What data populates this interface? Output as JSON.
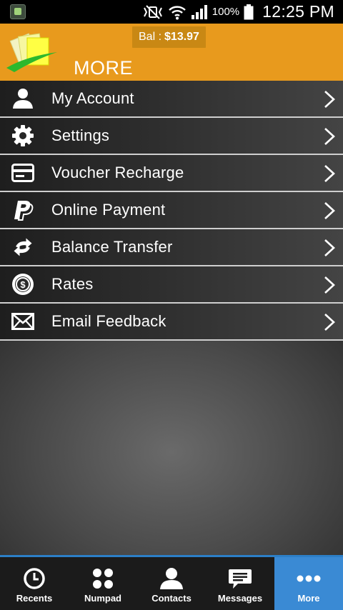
{
  "status_bar": {
    "battery_pct": "100%",
    "time": "12:25 PM"
  },
  "header": {
    "title": "MORE",
    "balance_label": "Bal :",
    "balance_value": "$13.97",
    "brand_color": "#e89a1d"
  },
  "menu": {
    "items": [
      {
        "label": "My Account",
        "icon": "user-icon"
      },
      {
        "label": "Settings",
        "icon": "gear-icon"
      },
      {
        "label": "Voucher Recharge",
        "icon": "card-icon"
      },
      {
        "label": "Online Payment",
        "icon": "paypal-icon"
      },
      {
        "label": "Balance Transfer",
        "icon": "transfer-arrows-icon"
      },
      {
        "label": "Rates",
        "icon": "dollar-badge-icon"
      },
      {
        "label": "Email Feedback",
        "icon": "envelope-icon"
      }
    ]
  },
  "bottom_nav": {
    "active_color": "#3a8ad4",
    "items": [
      {
        "label": "Recents",
        "icon": "clock-icon"
      },
      {
        "label": "Numpad",
        "icon": "numpad-icon"
      },
      {
        "label": "Contacts",
        "icon": "contact-icon"
      },
      {
        "label": "Messages",
        "icon": "message-icon"
      },
      {
        "label": "More",
        "icon": "more-dots-icon",
        "active": true
      }
    ]
  }
}
